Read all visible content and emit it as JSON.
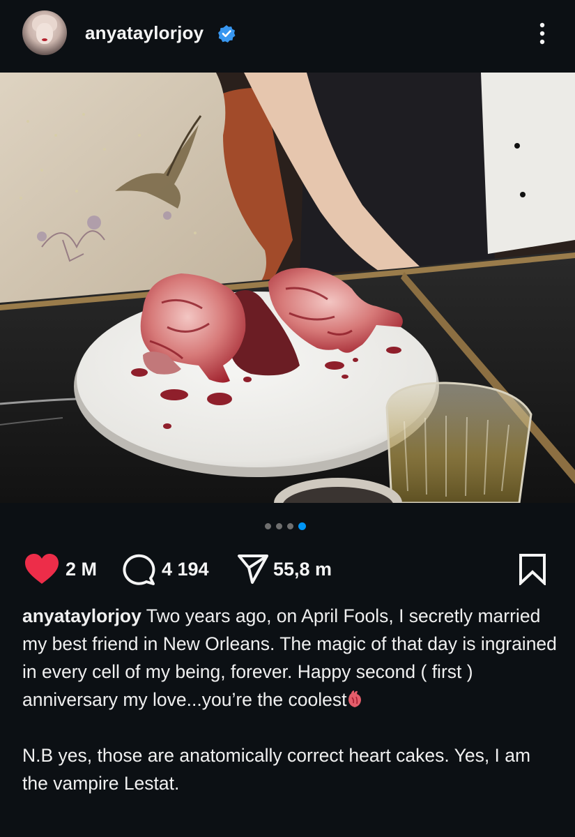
{
  "post": {
    "username": "anyataylorjoy",
    "verified": true,
    "photo": {
      "description": "Photo of a white cake board with two anatomically shaped heart cakes and red sauce, a glass of drink, a person in an embroidered hummingbird dress",
      "carousel_total": 4,
      "carousel_active": 4
    },
    "actions": {
      "likes": "2 M",
      "comments": "4 194",
      "shares": "55,8 m"
    },
    "caption": {
      "username": "anyataylorjoy",
      "line1": " Two years ago, on April Fools, I secretly married my best friend in New Orleans. The magic of that day is ingrained in every cell of my being, forever. Happy second ( first ) anniversary my love...you’re the coolest",
      "line2": "N.B yes, those are anatomically correct heart cakes. Yes, I am the vampire Lestat."
    }
  },
  "colors": {
    "background": "#0c1014",
    "like_red": "#ed2d49",
    "verified_blue": "#3897f0",
    "dot_active": "#0095f6",
    "dot_inactive": "#6f6f6f"
  },
  "icons": {
    "more": "more-vertical-icon",
    "like": "heart-filled-icon",
    "comment": "comment-bubble-icon",
    "share": "send-paper-plane-icon",
    "save": "bookmark-icon",
    "caption_emoji": "anatomical-heart-icon"
  }
}
